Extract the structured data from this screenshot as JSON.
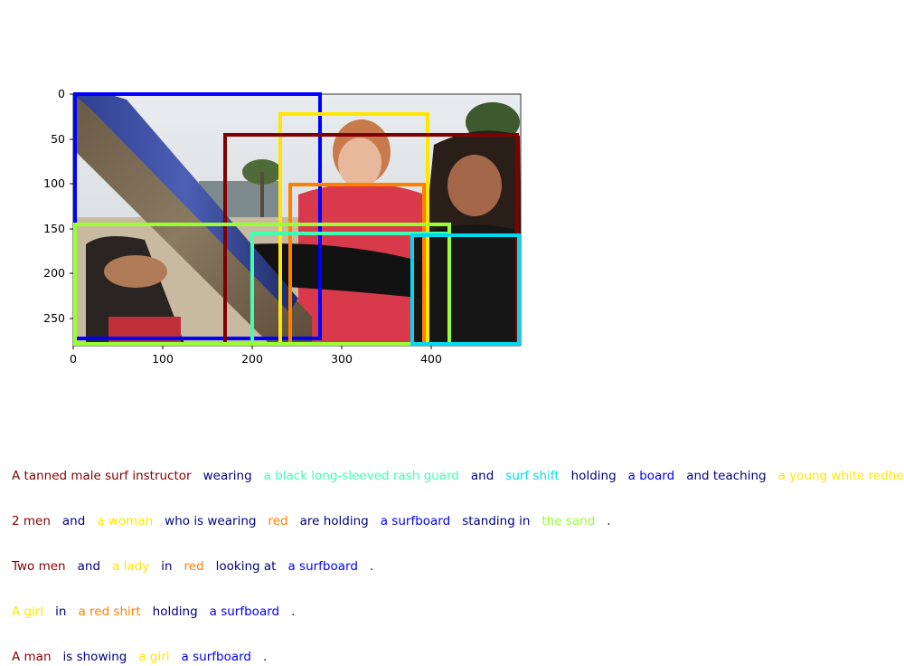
{
  "image": {
    "description": "Photo with a surfboard in the foreground, a young woman in a red rash guard in the center and a tanned man in a black long-sleeved top on the right",
    "x_ticks": [
      "0",
      "100",
      "200",
      "300",
      "400"
    ],
    "y_ticks": [
      "0",
      "50",
      "100",
      "150",
      "200",
      "250"
    ],
    "boxes": [
      {
        "name": "board",
        "color": "#0000ff"
      },
      {
        "name": "woman",
        "color": "#ffe600"
      },
      {
        "name": "man",
        "color": "#800000"
      },
      {
        "name": "red-shirt",
        "color": "#ff7f00"
      },
      {
        "name": "black-rash-guard",
        "color": "#40ffb0"
      },
      {
        "name": "sand",
        "color": "#99ff33"
      },
      {
        "name": "surf-shift",
        "color": "#00d8ee"
      }
    ]
  },
  "captions": [
    [
      {
        "text": "A tanned male surf instructor",
        "color": "#800000"
      },
      {
        "text": "wearing",
        "color": "#000080"
      },
      {
        "text": "a black long-sleeved rash guard",
        "color": "#40ffb0"
      },
      {
        "text": "and",
        "color": "#000080"
      },
      {
        "text": "surf shift",
        "color": "#00d8ee"
      },
      {
        "text": "holding",
        "color": "#000080"
      },
      {
        "text": "a board",
        "color": "#0000ff"
      },
      {
        "text": "and teaching",
        "color": "#000080"
      },
      {
        "text": "a young white redhead",
        "color": "#ffe600"
      }
    ],
    [
      {
        "text": "2 men",
        "color": "#800000"
      },
      {
        "text": "and",
        "color": "#000080"
      },
      {
        "text": "a woman",
        "color": "#ffe600"
      },
      {
        "text": "who is wearing",
        "color": "#000080"
      },
      {
        "text": "red",
        "color": "#ff7f00"
      },
      {
        "text": "are holding",
        "color": "#000080"
      },
      {
        "text": "a surfboard",
        "color": "#0000ff"
      },
      {
        "text": "standing in",
        "color": "#000080"
      },
      {
        "text": "the sand",
        "color": "#99ff33"
      },
      {
        "text": ".",
        "color": "#000080"
      }
    ],
    [
      {
        "text": "Two men",
        "color": "#800000"
      },
      {
        "text": "and",
        "color": "#000080"
      },
      {
        "text": "a lady",
        "color": "#ffe600"
      },
      {
        "text": "in",
        "color": "#000080"
      },
      {
        "text": "red",
        "color": "#ff7f00"
      },
      {
        "text": "looking at",
        "color": "#000080"
      },
      {
        "text": "a surfboard",
        "color": "#0000ff"
      },
      {
        "text": ".",
        "color": "#000080"
      }
    ],
    [
      {
        "text": "A girl",
        "color": "#ffe600"
      },
      {
        "text": "in",
        "color": "#000080"
      },
      {
        "text": "a red shirt",
        "color": "#ff7f00"
      },
      {
        "text": "holding",
        "color": "#000080"
      },
      {
        "text": "a surfboard",
        "color": "#0000ff"
      },
      {
        "text": ".",
        "color": "#000080"
      }
    ],
    [
      {
        "text": "A man",
        "color": "#800000"
      },
      {
        "text": "is showing",
        "color": "#000080"
      },
      {
        "text": "a girl",
        "color": "#ffe600"
      },
      {
        "text": "a surfboard",
        "color": "#0000ff"
      },
      {
        "text": ".",
        "color": "#000080"
      }
    ]
  ]
}
